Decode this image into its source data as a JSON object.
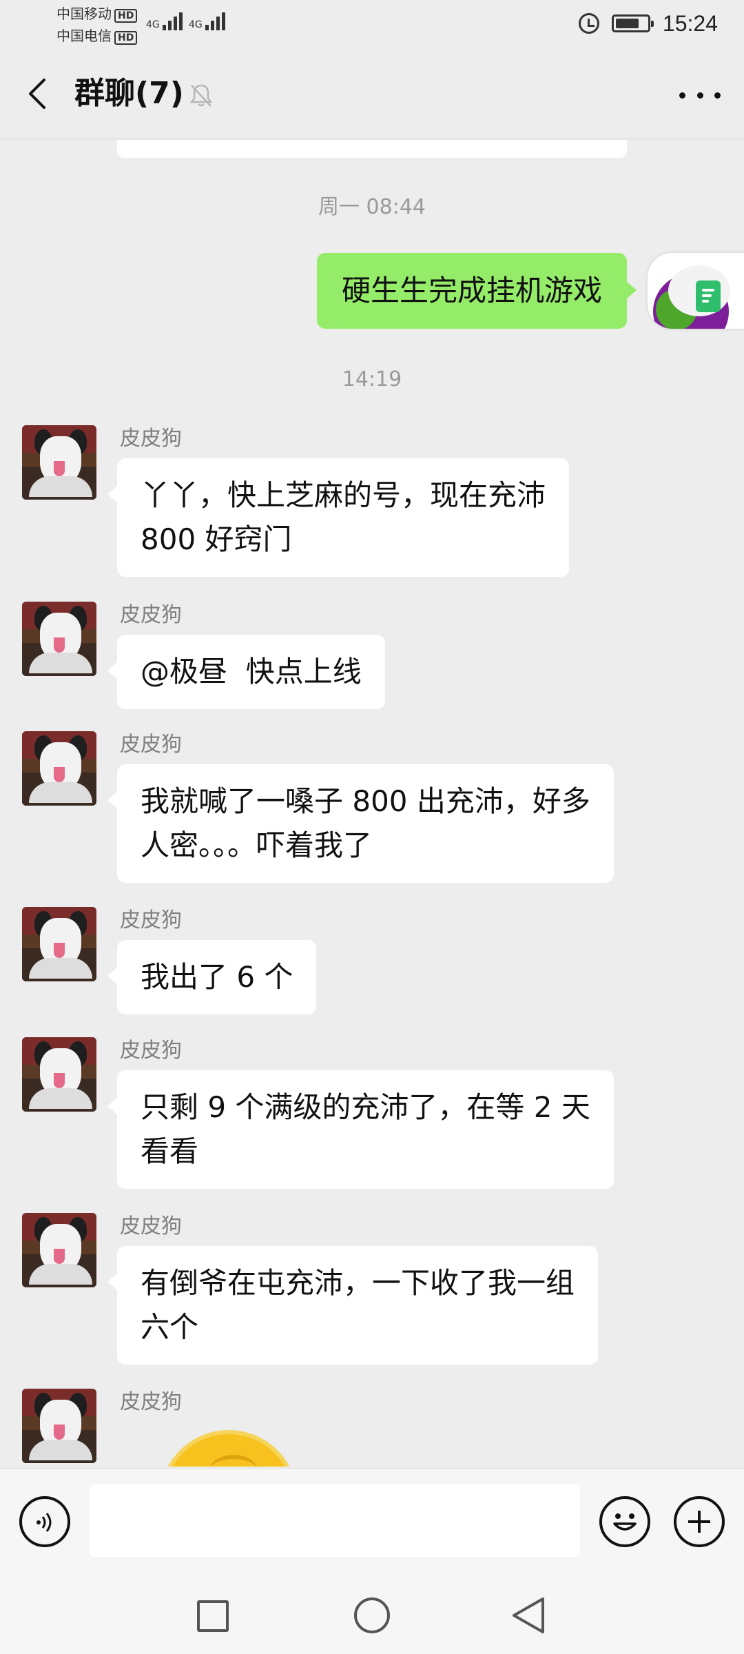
{
  "status_bar": {
    "carrier_1": "中国移动",
    "carrier_2": "中国电信",
    "hd_badge": "HD",
    "network_1": "4G",
    "network_2": "4G",
    "time": "15:24",
    "battery_level": 0.75,
    "icons": [
      "alarm-icon",
      "battery-icon"
    ]
  },
  "header": {
    "title": "群聊(7)",
    "icons": [
      "back-icon",
      "mute-icon",
      "more-icon"
    ]
  },
  "chat": {
    "timestamps": [
      "周一 08:44",
      "14:19"
    ],
    "outgoing": [
      {
        "text": "硬生生完成挂机游戏"
      }
    ],
    "messages": [
      {
        "sender": "皮皮狗",
        "text": "丫丫，快上芝麻的号，现在充沛\n800 好窍门"
      },
      {
        "sender": "皮皮狗",
        "text": "@极昼  快点上线"
      },
      {
        "sender": "皮皮狗",
        "text": "我就喊了一嗓子 800 出充沛，好多\n人密。。。吓着我了"
      },
      {
        "sender": "皮皮狗",
        "text": "我出了 6 个"
      },
      {
        "sender": "皮皮狗",
        "text": "只剩 9 个满级的充沛了，在等 2 天\n看看"
      },
      {
        "sender": "皮皮狗",
        "text": "有倒爷在屯充沛，一下收了我一组\n六个"
      },
      {
        "sender": "皮皮狗",
        "text": ""
      }
    ]
  },
  "input_bar": {
    "value": "",
    "icons": [
      "voice-icon",
      "emoji-icon",
      "plus-icon"
    ]
  },
  "nav_bar": {
    "icons": [
      "recent-apps-icon",
      "home-icon",
      "back-nav-icon"
    ]
  },
  "colors": {
    "background": "#ededed",
    "outgoing_bubble": "#95ec69",
    "incoming_bubble": "#ffffff",
    "secondary_text": "#9a9a9a"
  }
}
